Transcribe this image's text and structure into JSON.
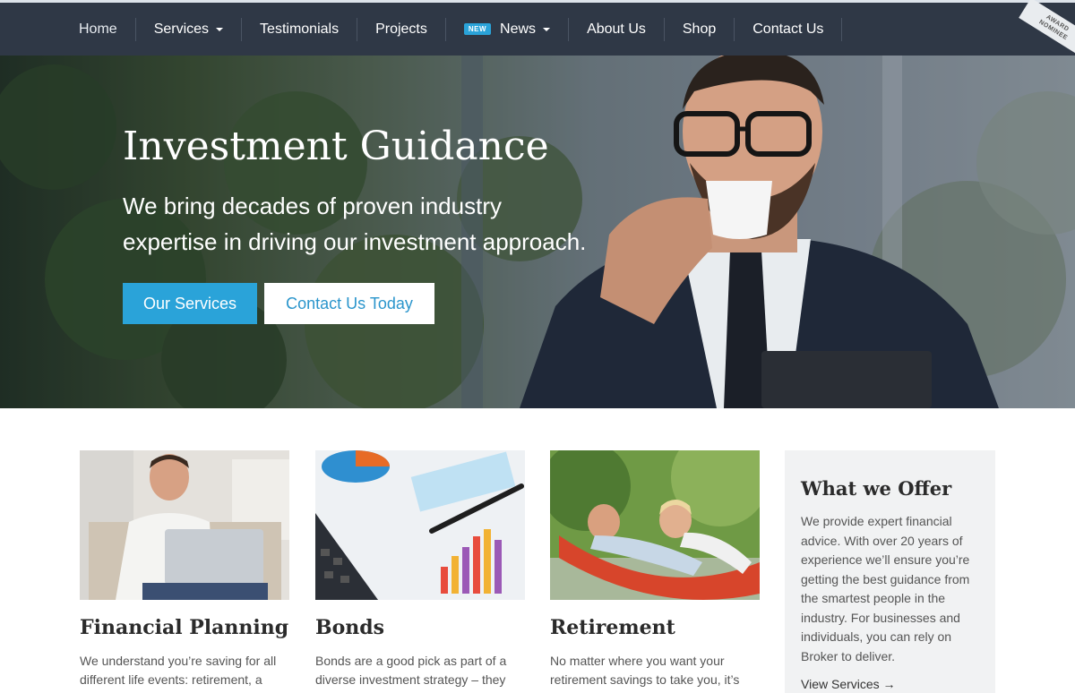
{
  "nav": {
    "items": [
      {
        "label": "Home"
      },
      {
        "label": "Services"
      },
      {
        "label": "Testimonials"
      },
      {
        "label": "Projects"
      },
      {
        "label": "News"
      },
      {
        "label": "About Us"
      },
      {
        "label": "Shop"
      },
      {
        "label": "Contact Us"
      }
    ],
    "news_badge": "NEW",
    "award_line1": "AWARD",
    "award_line2": "NOMINEE"
  },
  "hero": {
    "title": "Investment Guidance",
    "subtitle": "We bring decades of proven industry expertise in driving our investment approach.",
    "primary_button": "Our Services",
    "secondary_button": "Contact Us Today"
  },
  "cards": [
    {
      "title": "Financial Planning",
      "text": "We understand you’re saving for all different life events: retirement, a house"
    },
    {
      "title": "Bonds",
      "text": "Bonds are a good pick as part of a diverse investment strategy – they offer"
    },
    {
      "title": "Retirement",
      "text": "No matter where you want your retirement savings to take you, it’s quick"
    }
  ],
  "offer": {
    "title": "What we Offer",
    "text": "We provide expert financial advice. With over 20 years of experience we’ll ensure you’re getting the best guidance from the smartest people in the industry. For businesses and individuals, you can rely on Broker to deliver.",
    "link": "View Services →"
  },
  "colors": {
    "nav_bg": "#2f3846",
    "accent": "#2aa3d9"
  }
}
